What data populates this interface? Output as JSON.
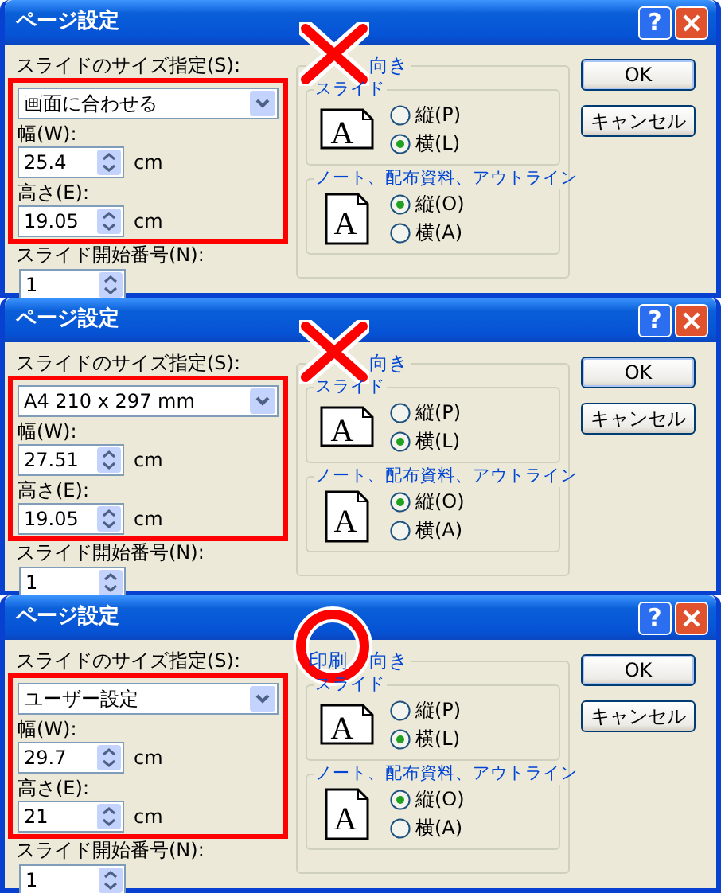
{
  "dialogs": [
    {
      "title": "ページ設定",
      "help_button": "?",
      "annotation": {
        "kind": "cross"
      },
      "size_label": "スライドのサイズ指定(S):",
      "size_value": "画面に合わせる",
      "width": {
        "label": "幅(W):",
        "value": "25.4",
        "unit": "cm"
      },
      "height": {
        "label": "高さ(E):",
        "value": "19.05",
        "unit": "cm"
      },
      "start_number": {
        "label": "スライド開始番号(N):",
        "value": "1"
      },
      "orientation": {
        "title_parts": [
          "向き"
        ],
        "groups": [
          {
            "title": "スライド",
            "icon_letter": "A",
            "options": [
              {
                "label": "縦(P)",
                "selected": false
              },
              {
                "label": "横(L)",
                "selected": true
              }
            ]
          },
          {
            "title": "ノート、配布資料、アウトライン",
            "icon_letter": "A",
            "options": [
              {
                "label": "縦(O)",
                "selected": true
              },
              {
                "label": "横(A)",
                "selected": false
              }
            ]
          }
        ]
      },
      "buttons": [
        "OK",
        "キャンセル"
      ]
    },
    {
      "title": "ページ設定",
      "help_button": "?",
      "annotation": {
        "kind": "cross"
      },
      "size_label": "スライドのサイズ指定(S):",
      "size_value": "A4 210 x 297 mm",
      "width": {
        "label": "幅(W):",
        "value": "27.51",
        "unit": "cm"
      },
      "height": {
        "label": "高さ(E):",
        "value": "19.05",
        "unit": "cm"
      },
      "start_number": {
        "label": "スライド開始番号(N):",
        "value": "1"
      },
      "orientation": {
        "title_parts": [
          "向き"
        ],
        "groups": [
          {
            "title": "スライド",
            "icon_letter": "A",
            "options": [
              {
                "label": "縦(P)",
                "selected": false
              },
              {
                "label": "横(L)",
                "selected": true
              }
            ]
          },
          {
            "title": "ノート、配布資料、アウトライン",
            "icon_letter": "A",
            "options": [
              {
                "label": "縦(O)",
                "selected": true
              },
              {
                "label": "横(A)",
                "selected": false
              }
            ]
          }
        ]
      },
      "buttons": [
        "OK",
        "キャンセル"
      ]
    },
    {
      "title": "ページ設定",
      "help_button": "?",
      "annotation": {
        "kind": "circle"
      },
      "size_label": "スライドのサイズ指定(S):",
      "size_value": "ユーザー設定",
      "width": {
        "label": "幅(W):",
        "value": "29.7",
        "unit": "cm"
      },
      "height": {
        "label": "高さ(E):",
        "value": "21",
        "unit": "cm"
      },
      "start_number": {
        "label": "スライド開始番号(N):",
        "value": "1"
      },
      "orientation": {
        "title_parts": [
          "印刷",
          "向き"
        ],
        "groups": [
          {
            "title": "スライド",
            "icon_letter": "A",
            "options": [
              {
                "label": "縦(P)",
                "selected": false
              },
              {
                "label": "横(L)",
                "selected": true
              }
            ]
          },
          {
            "title": "ノート、配布資料、アウトライン",
            "icon_letter": "A",
            "options": [
              {
                "label": "縦(O)",
                "selected": true
              },
              {
                "label": "横(A)",
                "selected": false
              }
            ]
          }
        ]
      },
      "buttons": [
        "OK",
        "キャンセル"
      ]
    }
  ]
}
